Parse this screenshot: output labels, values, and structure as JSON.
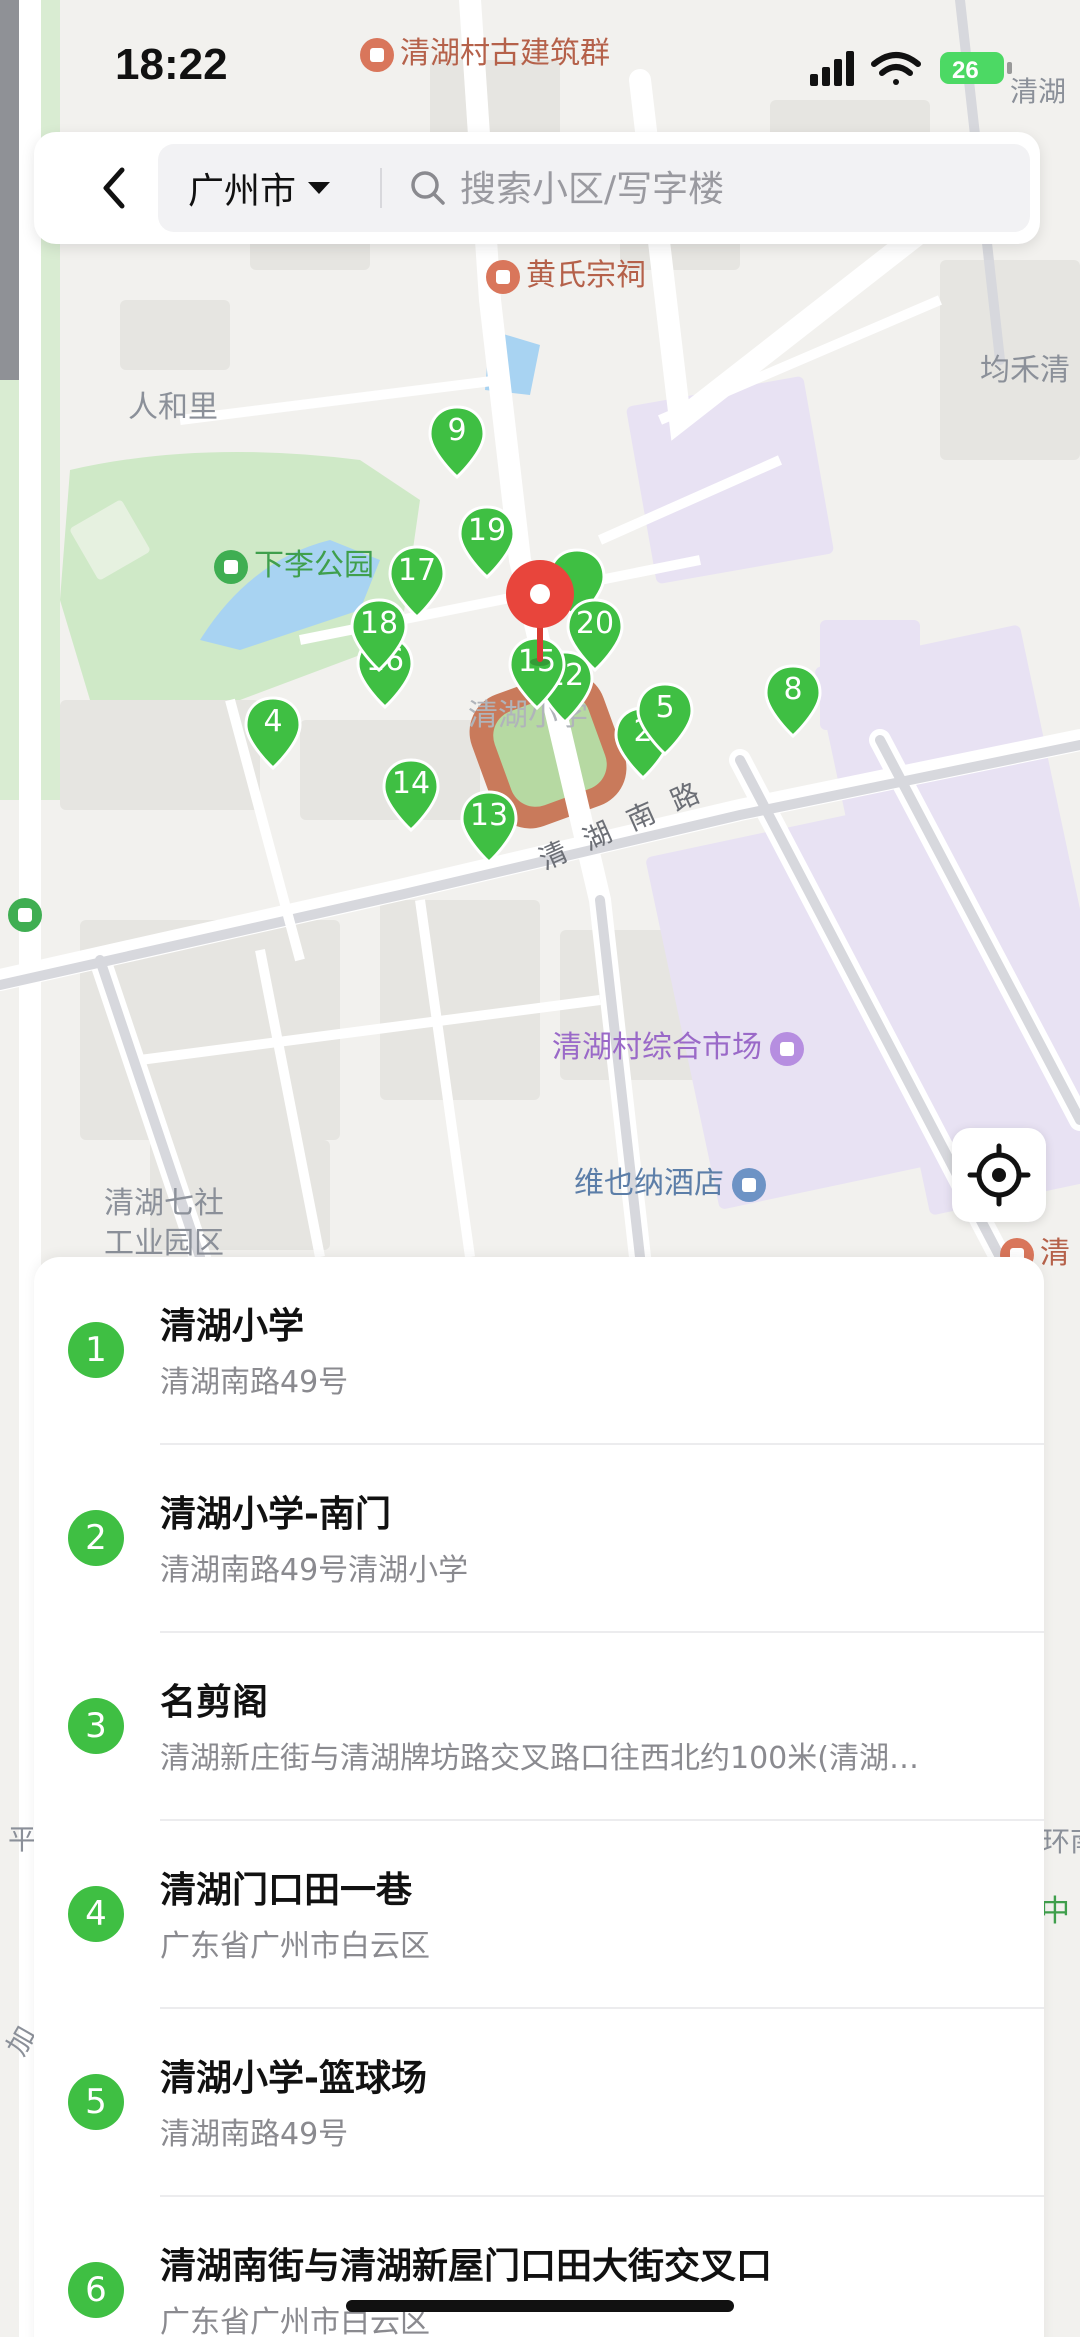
{
  "status_bar": {
    "time": "18:22",
    "battery": "26"
  },
  "search": {
    "city": "广州市",
    "placeholder": "搜索小区/写字楼"
  },
  "map": {
    "labels": {
      "village_buildings": "清湖村古建筑群",
      "huang_ancestral": "黄氏宗祠",
      "renheli": "人和里",
      "xiali_park": "下李公园",
      "junhe": "均禾清",
      "school_partial": "清湖小学",
      "road_qinghu_south": "清湖南路",
      "market": "清湖村综合市场",
      "hotel": "维也纳酒店",
      "industrial_park_line1": "清湖七社",
      "industrial_park_line2": "工业园区",
      "top_right": "清湖",
      "right_edge": "清",
      "right_edge_2": "环南",
      "right_edge_3": "中",
      "left_edge": "平",
      "left_edge_2": "加"
    },
    "pins": [
      "9",
      "19",
      "17",
      "18",
      "16",
      "15",
      "12",
      "20",
      "5",
      "8",
      "4",
      "14",
      "13",
      "2"
    ]
  },
  "results": [
    {
      "number": "1",
      "title": "清湖小学",
      "address": "清湖南路49号"
    },
    {
      "number": "2",
      "title": "清湖小学-南门",
      "address": "清湖南路49号清湖小学"
    },
    {
      "number": "3",
      "title": "名剪阁",
      "address": "清湖新庄街与清湖牌坊路交叉路口往西北约100米(清湖…"
    },
    {
      "number": "4",
      "title": "清湖门口田一巷",
      "address": "广东省广州市白云区"
    },
    {
      "number": "5",
      "title": "清湖小学-篮球场",
      "address": "清湖南路49号"
    },
    {
      "number": "6",
      "title": "清湖南街与清湖新屋门口田大街交叉口",
      "address": "广东省广州市白云区"
    }
  ],
  "colors": {
    "pin_green": "#3fbf43",
    "selected_pin": "#e8453c"
  }
}
